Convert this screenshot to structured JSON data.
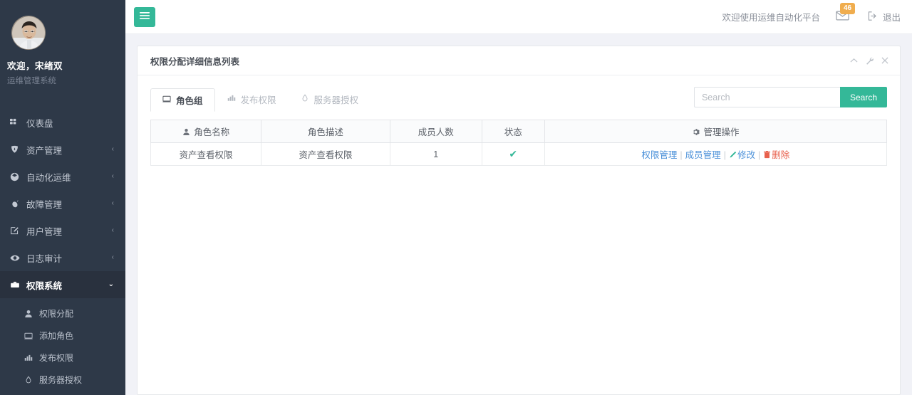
{
  "sidebar": {
    "profile": {
      "greeting": "欢迎，宋绪双",
      "subtitle": "运维管理系统",
      "avatar_icon": "user-avatar-photo"
    },
    "items": [
      {
        "label": "仪表盘",
        "icon": "dashboard-grid-icon",
        "chevron": "",
        "active": false
      },
      {
        "label": "资产管理",
        "icon": "shield-icon",
        "chevron": "‹",
        "active": false
      },
      {
        "label": "自动化运维",
        "icon": "cube-icon",
        "chevron": "‹",
        "active": false
      },
      {
        "label": "故障管理",
        "icon": "bug-icon",
        "chevron": "‹",
        "active": false
      },
      {
        "label": "用户管理",
        "icon": "edit-square-icon",
        "chevron": "‹",
        "active": false
      },
      {
        "label": "日志审计",
        "icon": "eye-icon",
        "chevron": "‹",
        "active": false
      },
      {
        "label": "权限系统",
        "icon": "briefcase-icon",
        "chevron": "⌄",
        "active": true
      }
    ],
    "subitems": [
      {
        "label": "权限分配",
        "icon": "user-icon"
      },
      {
        "label": "添加角色",
        "icon": "monitor-icon"
      },
      {
        "label": "发布权限",
        "icon": "bar-chart-icon"
      },
      {
        "label": "服务器授权",
        "icon": "server-icon"
      }
    ]
  },
  "topbar": {
    "menu_toggle_icon": "hamburger-icon",
    "welcome": "欢迎使用运维自动化平台",
    "mail_icon": "envelope-icon",
    "mail_badge": "46",
    "logout_icon": "sign-out-icon",
    "logout_label": "退出"
  },
  "panel": {
    "title": "权限分配详细信息列表",
    "tools": [
      {
        "icon": "chevron-up-icon",
        "glyph": "⌃"
      },
      {
        "icon": "wrench-icon",
        "glyph": "⚒"
      },
      {
        "icon": "close-icon",
        "glyph": "✕"
      }
    ],
    "tabs": [
      {
        "label": "角色组",
        "icon": "monitor-icon",
        "active": true
      },
      {
        "label": "发布权限",
        "icon": "bar-chart-icon",
        "active": false
      },
      {
        "label": "服务器授权",
        "icon": "server-icon",
        "active": false
      }
    ],
    "search": {
      "placeholder": "Search",
      "value": "",
      "button_label": "Search"
    },
    "table": {
      "headers": [
        {
          "label": "角色名称",
          "icon": "user-icon"
        },
        {
          "label": "角色描述",
          "icon": ""
        },
        {
          "label": "成员人数",
          "icon": ""
        },
        {
          "label": "状态",
          "icon": ""
        },
        {
          "label": "管理操作",
          "icon": "gear-icon"
        }
      ],
      "rows": [
        {
          "name": "资产查看权限",
          "description": "资产查看权限",
          "members": "1",
          "status_icon": "check-icon",
          "status_glyph": "✔",
          "actions": [
            {
              "label": "权限管理",
              "icon": "",
              "style": "link"
            },
            {
              "label": "成员管理",
              "icon": "",
              "style": "link"
            },
            {
              "label": "修改",
              "icon": "pencil-icon",
              "style": "link"
            },
            {
              "label": "删除",
              "icon": "trash-icon",
              "style": "danger"
            }
          ]
        }
      ]
    }
  },
  "colors": {
    "sidebar_bg": "#2e3948",
    "sidebar_active_bg": "#29313e",
    "accent_green": "#34b898",
    "badge_orange": "#f0ad4e",
    "link_blue": "#4a90d9",
    "danger_red": "#e8604c",
    "page_bg": "#f1f2f7"
  }
}
